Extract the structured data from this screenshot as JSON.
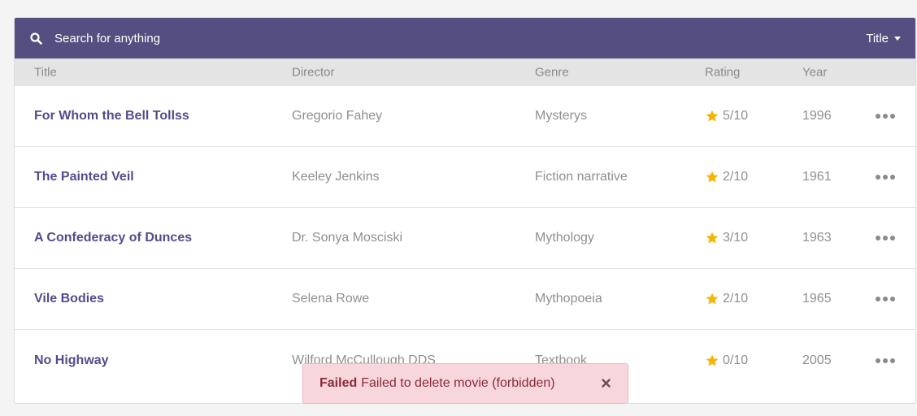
{
  "search": {
    "placeholder": "Search for anything"
  },
  "sort": {
    "label": "Title"
  },
  "columns": {
    "title": "Title",
    "director": "Director",
    "genre": "Genre",
    "rating": "Rating",
    "year": "Year"
  },
  "rows": [
    {
      "title": "For Whom the Bell Tollss",
      "director": "Gregorio Fahey",
      "genre": "Mysterys",
      "rating": "5/10",
      "year": "1996"
    },
    {
      "title": "The Painted Veil",
      "director": "Keeley Jenkins",
      "genre": "Fiction narrative",
      "rating": "2/10",
      "year": "1961"
    },
    {
      "title": "A Confederacy of Dunces",
      "director": "Dr. Sonya Mosciski",
      "genre": "Mythology",
      "rating": "3/10",
      "year": "1963"
    },
    {
      "title": "Vile Bodies",
      "director": "Selena Rowe",
      "genre": "Mythopoeia",
      "rating": "2/10",
      "year": "1965"
    },
    {
      "title": "No Highway",
      "director": "Wilford McCullough DDS",
      "genre": "Textbook",
      "rating": "0/10",
      "year": "2005"
    }
  ],
  "toast": {
    "strong": "Failed",
    "message": "Failed to delete movie (forbidden)",
    "close": "×"
  },
  "icons": {
    "search": "search-icon",
    "star": "star-icon",
    "more": "more-horizontal-icon",
    "caret": "caret-down-icon",
    "close": "close-icon"
  },
  "colors": {
    "topbar": "#544f80",
    "title_link": "#574a8c",
    "star": "#f5b400",
    "toast_bg": "#f7d6dc",
    "toast_text": "#8a2b39"
  }
}
